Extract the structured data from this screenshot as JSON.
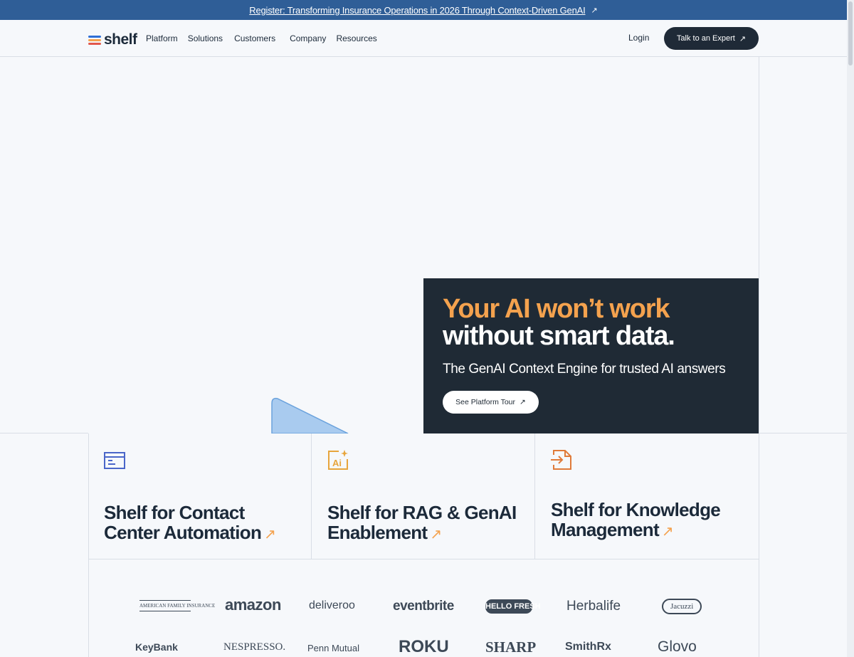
{
  "announcement": {
    "text": "Register: Transforming Insurance Operations in 2026 Through Context-Driven GenAI"
  },
  "nav": {
    "logo_text": "shelf",
    "items": [
      {
        "label": "Platform"
      },
      {
        "label": "Solutions"
      },
      {
        "label": "Customers"
      },
      {
        "label": "Company"
      },
      {
        "label": "Resources"
      }
    ],
    "login": "Login",
    "cta": "Talk to an Expert"
  },
  "hero": {
    "headline_line1": "Your AI won’t work",
    "headline_line2": "without smart data.",
    "subtitle": "The GenAI Context Engine for trusted AI answers",
    "button": "See Platform Tour"
  },
  "cards": [
    {
      "title": "Shelf for Contact Center Automation",
      "icon": "contact-center-icon"
    },
    {
      "title": "Shelf for RAG & GenAI Enablement",
      "icon": "ai-sparkle-icon"
    },
    {
      "title": "Shelf for Knowledge Management",
      "icon": "knowledge-import-icon"
    }
  ],
  "customer_logos": [
    "AMERICAN FAMILY INSURANCE",
    "amazon",
    "deliveroo",
    "eventbrite",
    "HELLO FRESH",
    "Herbalife",
    "Jacuzzi",
    "KeyBank",
    "NESPRESSO.",
    "Penn Mutual",
    "ROKU",
    "SHARP",
    "SmithRx",
    "Glovo"
  ],
  "colors": {
    "accent": "#f4a24e",
    "banner": "#2f5e97",
    "dark_panel": "#1f2a35",
    "logo_bars": [
      "#2f6fd6",
      "#f4a24e",
      "#e2574c"
    ]
  }
}
